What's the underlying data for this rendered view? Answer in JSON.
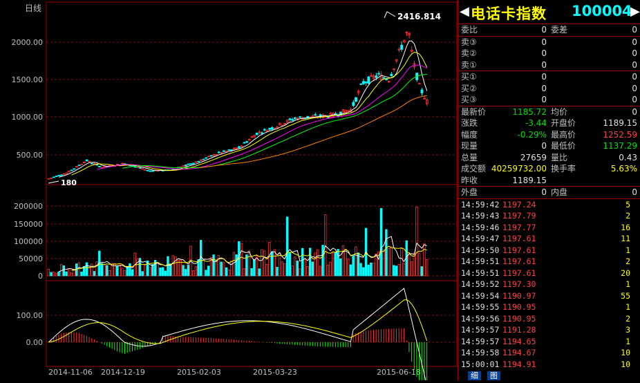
{
  "chart": {
    "period_label": "日线",
    "max_price_label": "2416.814",
    "min_price_label": "180",
    "price_ticks": [
      "2000.00",
      "1500.00",
      "1000.00",
      "500.00"
    ],
    "volume_ticks": [
      "200000",
      "150000",
      "100000",
      "50000",
      "0"
    ],
    "macd_ticks": [
      "100.00",
      "0.00"
    ],
    "date_labels": [
      "2014-11-06",
      "2014-12-19",
      "2015-02-03",
      "2015-03-23",
      "2015-06-18"
    ],
    "colors": {
      "up": "#ff3030",
      "down": "#00ffff",
      "ma5": "#ffffff",
      "ma10": "#ffff00",
      "ma20": "#ff00ff",
      "ma30": "#00ff00",
      "ma60": "#ff8000",
      "grid": "#a00000"
    }
  },
  "header": {
    "name": "电话卡指数",
    "code": "100004",
    "left_arrow": "◀",
    "right_arrow": "▶"
  },
  "order_book": {
    "weibi_label": "委比",
    "weibi": "0",
    "weicha_label": "委差",
    "weicha": "0",
    "asks": [
      {
        "label": "卖③",
        "price": "0",
        "vol": "0"
      },
      {
        "label": "卖②",
        "price": "0",
        "vol": "0"
      },
      {
        "label": "卖①",
        "price": "0",
        "vol": "0"
      }
    ],
    "bids": [
      {
        "label": "买①",
        "price": "0",
        "vol": "0"
      },
      {
        "label": "买②",
        "price": "0",
        "vol": "0"
      },
      {
        "label": "买③",
        "price": "0",
        "vol": "0"
      }
    ]
  },
  "quote": {
    "last_label": "最新价",
    "last": "1185.72",
    "avg_label": "均价",
    "avg": "0",
    "chg_label": "涨跌",
    "chg": "-3.44",
    "open_label": "开盘价",
    "open": "1189.15",
    "pct_label": "幅度",
    "pct": "-0.29%",
    "high_label": "最高价",
    "high": "1252.59",
    "cur_vol_label": "现量",
    "cur_vol": "0",
    "low_label": "最低价",
    "low": "1137.29",
    "total_vol_label": "总量",
    "total_vol": "27659",
    "vol_ratio_label": "量比",
    "vol_ratio": "0.43",
    "amount_label": "成交额",
    "amount": "40259732.00",
    "turnover_label": "换手率",
    "turnover": "5.63%",
    "prev_close_label": "昨收",
    "prev_close": "1189.15",
    "outer_label": "外盘",
    "outer": "0",
    "inner_label": "内盘",
    "inner": "0"
  },
  "trades": [
    {
      "time": "14:59:42",
      "price": "1197.24",
      "vol": "5"
    },
    {
      "time": "14:59:43",
      "price": "1197.79",
      "vol": "2"
    },
    {
      "time": "14:59:46",
      "price": "1197.77",
      "vol": "16"
    },
    {
      "time": "14:59:47",
      "price": "1197.61",
      "vol": "11"
    },
    {
      "time": "14:59:50",
      "price": "1197.61",
      "vol": "1"
    },
    {
      "time": "14:59:51",
      "price": "1197.61",
      "vol": "2"
    },
    {
      "time": "14:59:51",
      "price": "1197.61",
      "vol": "20"
    },
    {
      "time": "14:59:52",
      "price": "1197.30",
      "vol": "1"
    },
    {
      "time": "14:59:54",
      "price": "1190.97",
      "vol": "55"
    },
    {
      "time": "14:59:55",
      "price": "1190.95",
      "vol": "1"
    },
    {
      "time": "14:59:56",
      "price": "1190.95",
      "vol": "2"
    },
    {
      "time": "14:59:57",
      "price": "1191.28",
      "vol": "3"
    },
    {
      "time": "14:59:57",
      "price": "1194.65",
      "vol": "1"
    },
    {
      "time": "14:59:58",
      "price": "1194.67",
      "vol": "10"
    },
    {
      "time": "15:00:01",
      "price": "1194.91",
      "vol": "10"
    }
  ],
  "tabs": [
    "细",
    "图"
  ]
}
